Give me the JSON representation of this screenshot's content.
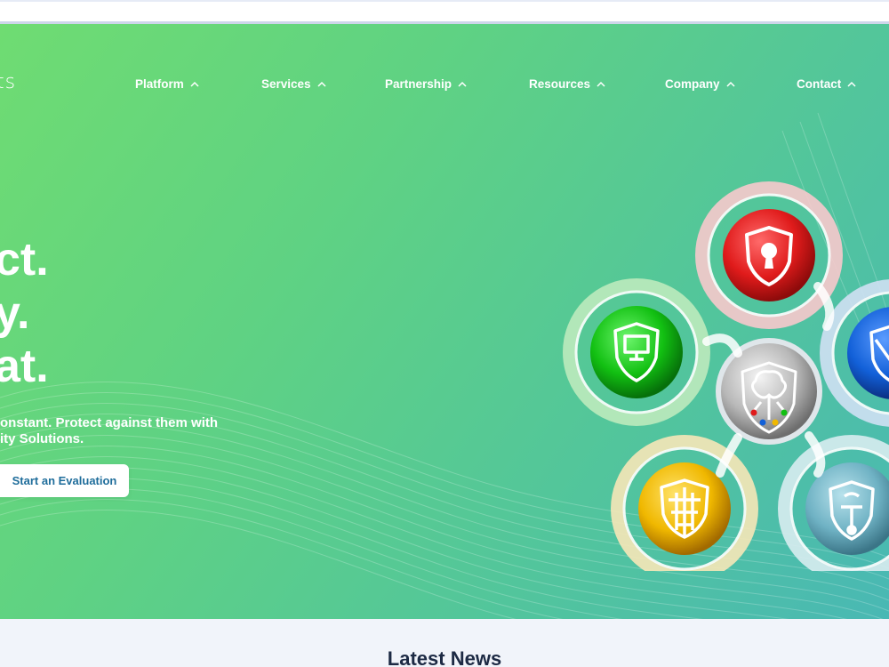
{
  "header": {
    "logo_fragment": "ts",
    "nav": [
      {
        "label": "Platform"
      },
      {
        "label": "Services"
      },
      {
        "label": "Partnership"
      },
      {
        "label": "Resources"
      },
      {
        "label": "Company"
      },
      {
        "label": "Contact"
      }
    ]
  },
  "hero": {
    "headline_lines": [
      "ct.",
      "y.",
      "at."
    ],
    "tagline_lines": [
      "onstant. Protect against them with",
      "ity Solutions."
    ],
    "cta_label": "Start an Evaluation"
  },
  "illustration": {
    "icons": [
      "lock-shield-icon",
      "monitor-shield-icon",
      "brain-shield-icon",
      "network-shield-icon",
      "honeycomb-shield-icon",
      "signal-shield-icon"
    ]
  },
  "news": {
    "title": "Latest News"
  },
  "colors": {
    "hero_gradient_start": "#6fdc72",
    "hero_gradient_end": "#49b8b4",
    "cta_text": "#1f6d9b",
    "red_orb": "#e01b1b",
    "green_orb": "#12c012",
    "blue_orb": "#1260d8",
    "yellow_orb": "#f0b800",
    "gray_orb": "#b8b8b8",
    "teal_orb": "#6fb2c4"
  }
}
